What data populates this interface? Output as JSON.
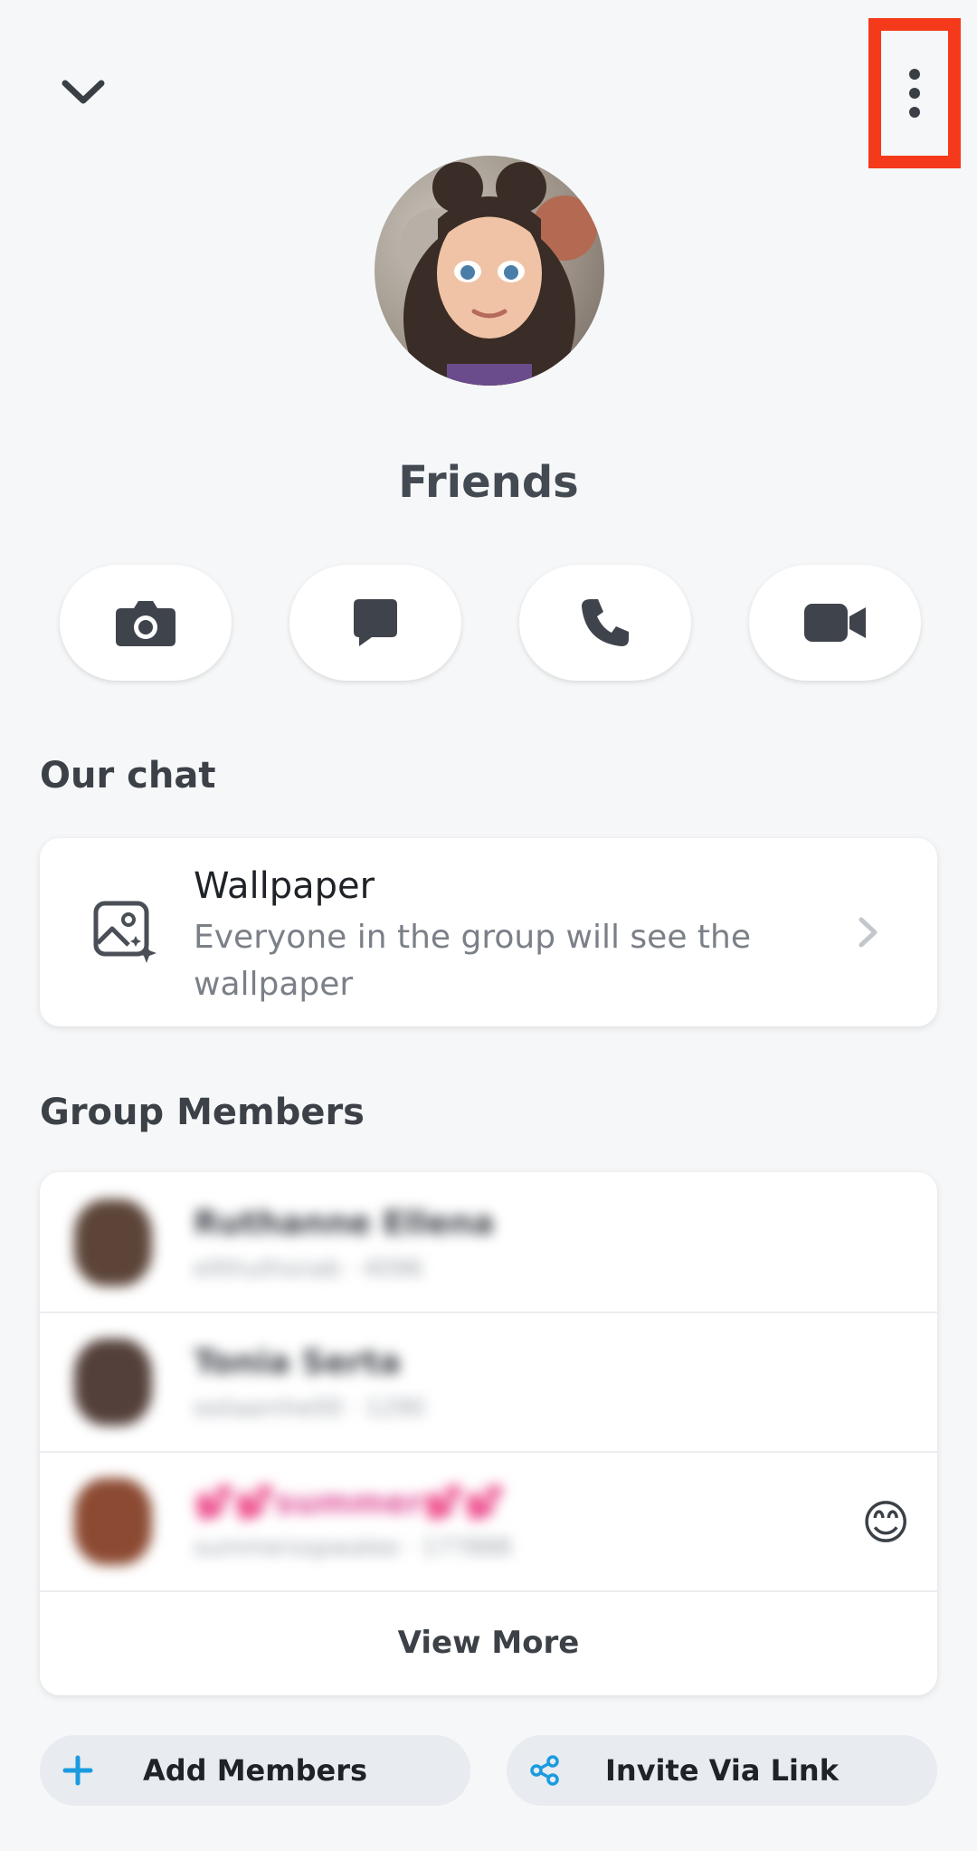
{
  "header": {
    "back_icon": "chevron-down-icon",
    "menu_icon": "more-vertical-icon",
    "highlight_color": "#f43a1b"
  },
  "group": {
    "name": "Friends"
  },
  "actions": [
    {
      "icon": "camera-icon"
    },
    {
      "icon": "chat-icon"
    },
    {
      "icon": "phone-icon"
    },
    {
      "icon": "video-icon"
    }
  ],
  "our_chat": {
    "title": "Our chat",
    "wallpaper": {
      "icon": "wallpaper-icon",
      "title": "Wallpaper",
      "subtitle": "Everyone in the group will see the wallpaper"
    }
  },
  "members": {
    "title": "Group Members",
    "rows": [
      {
        "name": "Ruthanne Ellena",
        "sub": "ellthuthsnab · 4096"
      },
      {
        "name": "Tonia Serta",
        "sub": "ootaamhe00 · 1290"
      },
      {
        "name": "💕💕summer💕💕",
        "sub": "summersspwalee · 177888",
        "emoji": "😊"
      }
    ],
    "view_more": "View More"
  },
  "buttons": {
    "add_members": "Add Members",
    "invite_link": "Invite Via Link"
  },
  "colors": {
    "background": "#f6f7f8",
    "accent_blue": "#1a9be0",
    "text_dark": "#3c4148"
  }
}
